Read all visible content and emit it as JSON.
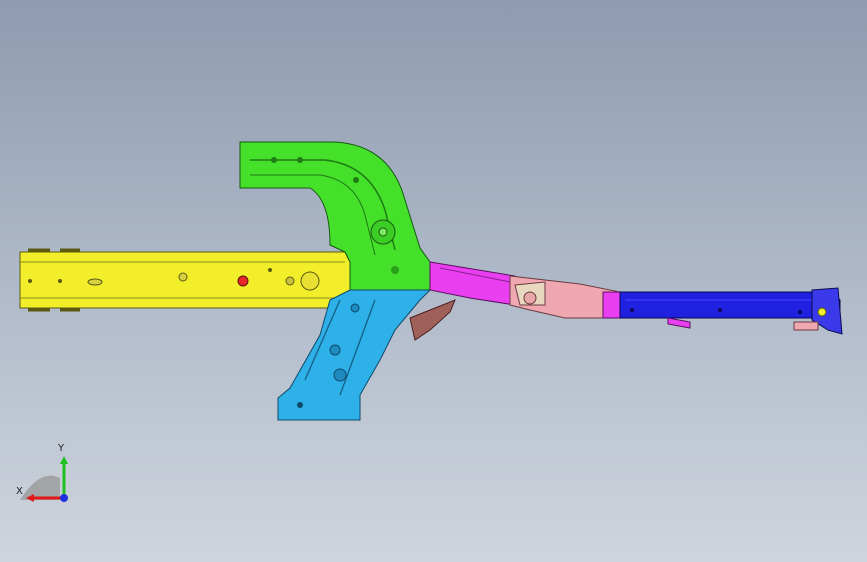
{
  "viewport": {
    "background_top": "#8e9bb0",
    "background_bottom": "#cfd5dd"
  },
  "model": {
    "parts": [
      {
        "name": "yellow-longitudinal-rail",
        "color": "#f2ef2a"
      },
      {
        "name": "green-upper-bracket",
        "color": "#44e02a"
      },
      {
        "name": "cyan-lower-bracket",
        "color": "#2eb0e8"
      },
      {
        "name": "magenta-transition-section",
        "color": "#ea3ff0"
      },
      {
        "name": "pink-kick-up-section",
        "color": "#f0a8b0"
      },
      {
        "name": "blue-rear-rail",
        "color": "#2020e0"
      },
      {
        "name": "brown-bracket",
        "color": "#a0605a"
      }
    ]
  },
  "triad": {
    "x_label": "X",
    "y_label": "Y",
    "x_color": "#e01818",
    "y_color": "#20c020",
    "z_color": "#2030e0"
  }
}
